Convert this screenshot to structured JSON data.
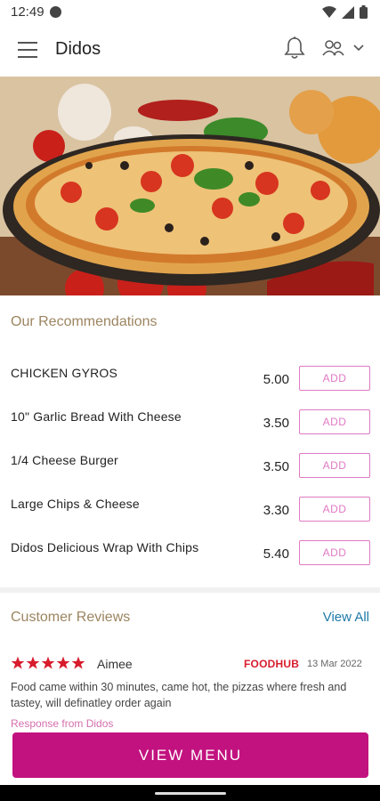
{
  "status_bar": {
    "time": "12:49"
  },
  "app_bar": {
    "title": "Didos"
  },
  "recommendations": {
    "title": "Our Recommendations",
    "items": [
      {
        "name": "CHICKEN GYROS",
        "price": "5.00",
        "action": "ADD"
      },
      {
        "name": "10\" Garlic Bread With Cheese",
        "price": "3.50",
        "action": "ADD"
      },
      {
        "name": "1/4 Cheese Burger",
        "price": "3.50",
        "action": "ADD"
      },
      {
        "name": "Large Chips & Cheese",
        "price": "3.30",
        "action": "ADD"
      },
      {
        "name": "Didos Delicious Wrap With Chips",
        "price": "5.40",
        "action": "ADD"
      }
    ]
  },
  "reviews": {
    "title": "Customer Reviews",
    "view_all": "View All",
    "items": [
      {
        "rating": 5,
        "reviewer": "Aimee",
        "source": "FOODHUB",
        "date": "13 Mar 2022",
        "text": "Food came within 30 minutes, came hot, the pizzas where fresh and tastey, will definatley order again",
        "response_label": "Response from Didos"
      }
    ]
  },
  "cta": {
    "view_menu": "VIEW MENU"
  },
  "colors": {
    "accent": "#c2127f",
    "add_border": "#e07ac4",
    "section_title": "#9c8560",
    "link": "#1e7aa8",
    "star": "#d81c2c"
  }
}
